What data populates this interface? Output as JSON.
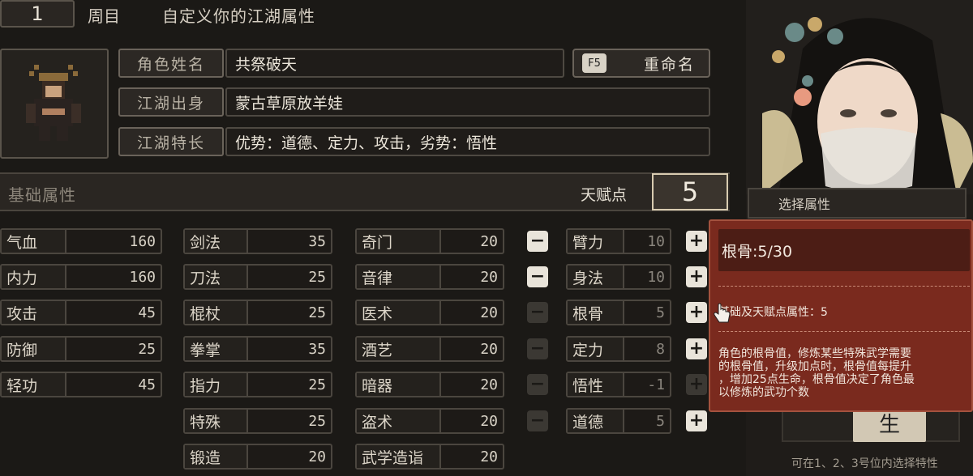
{
  "header": {
    "round_number": "1",
    "round_label": "周目",
    "title": "自定义你的江湖属性"
  },
  "profile": {
    "name_label": "角色姓名",
    "name_value": "共祭破天",
    "rename_key": "F5",
    "rename_label": "重命名",
    "origin_label": "江湖出身",
    "origin_value": "蒙古草原放羊娃",
    "trait_label": "江湖特长",
    "trait_value": "优势：道德、定力、攻击，劣势：悟性"
  },
  "basic_attr": {
    "title": "基础属性",
    "talent_label": "天赋点",
    "talent_points": "5"
  },
  "col1": [
    {
      "name": "气血",
      "value": "160"
    },
    {
      "name": "内力",
      "value": "160"
    },
    {
      "name": "攻击",
      "value": "45"
    },
    {
      "name": "防御",
      "value": "25"
    },
    {
      "name": "轻功",
      "value": "45"
    }
  ],
  "col2": [
    {
      "name": "剑法",
      "value": "35"
    },
    {
      "name": "刀法",
      "value": "25"
    },
    {
      "name": "棍杖",
      "value": "25"
    },
    {
      "name": "拳掌",
      "value": "35"
    },
    {
      "name": "指力",
      "value": "25"
    },
    {
      "name": "特殊",
      "value": "25"
    },
    {
      "name": "锻造",
      "value": "20"
    }
  ],
  "col3": [
    {
      "name": "奇门",
      "value": "20"
    },
    {
      "name": "音律",
      "value": "20"
    },
    {
      "name": "医术",
      "value": "20"
    },
    {
      "name": "酒艺",
      "value": "20"
    },
    {
      "name": "暗器",
      "value": "20"
    },
    {
      "name": "盗术",
      "value": "20"
    },
    {
      "name": "武学造诣",
      "value": "20"
    }
  ],
  "col4": [
    {
      "name": "臂力",
      "value": "10",
      "minus": "−",
      "plus": "+"
    },
    {
      "name": "身法",
      "value": "10",
      "minus": "−",
      "plus": "+"
    },
    {
      "name": "根骨",
      "value": "5",
      "minus": "−",
      "plus": "+"
    },
    {
      "name": "定力",
      "value": "8",
      "minus": "−",
      "plus": "+"
    },
    {
      "name": "悟性",
      "value": "-1",
      "minus": "−",
      "plus": "+"
    },
    {
      "name": "道德",
      "value": "5",
      "minus": "−",
      "plus": "+"
    }
  ],
  "right_panel": {
    "select_label": "选择属性",
    "footer_text": "可在1、2、3号位内选择特性",
    "emblem_glyph": "生"
  },
  "tooltip": {
    "title": "根骨:5/30",
    "sub": "基础及天赋点属性：5",
    "desc_lines": [
      "角色的根骨值，修炼某些特殊武学需要",
      "的根骨值，升级加点时，根骨值每提升",
      "，增加25点生命，根骨值决定了角色最",
      "以修炼的武功个数"
    ]
  }
}
